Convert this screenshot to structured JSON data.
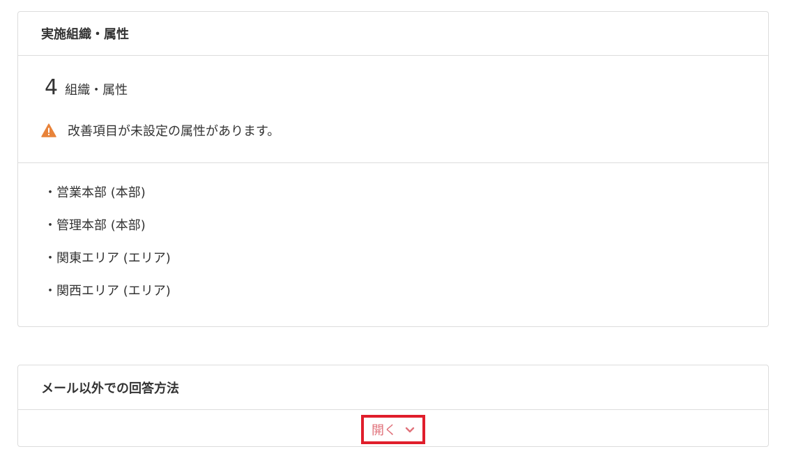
{
  "org_section": {
    "title": "実施組織・属性",
    "count": "4",
    "count_unit": "組織・属性",
    "warning": "改善項目が未設定の属性があります。",
    "items": [
      "・営業本部 (本部)",
      "・管理本部 (本部)",
      "・関東エリア (エリア)",
      "・関西エリア (エリア)"
    ]
  },
  "alt_section": {
    "title": "メール以外での回答方法",
    "toggle_label": "開く"
  },
  "icons": {
    "warning": "warning-triangle-icon",
    "toggle": "chevron-down-icon"
  },
  "colors": {
    "warning": "#e8833a",
    "toggle_text": "#e0717a",
    "highlight_border": "#e01e2b"
  }
}
